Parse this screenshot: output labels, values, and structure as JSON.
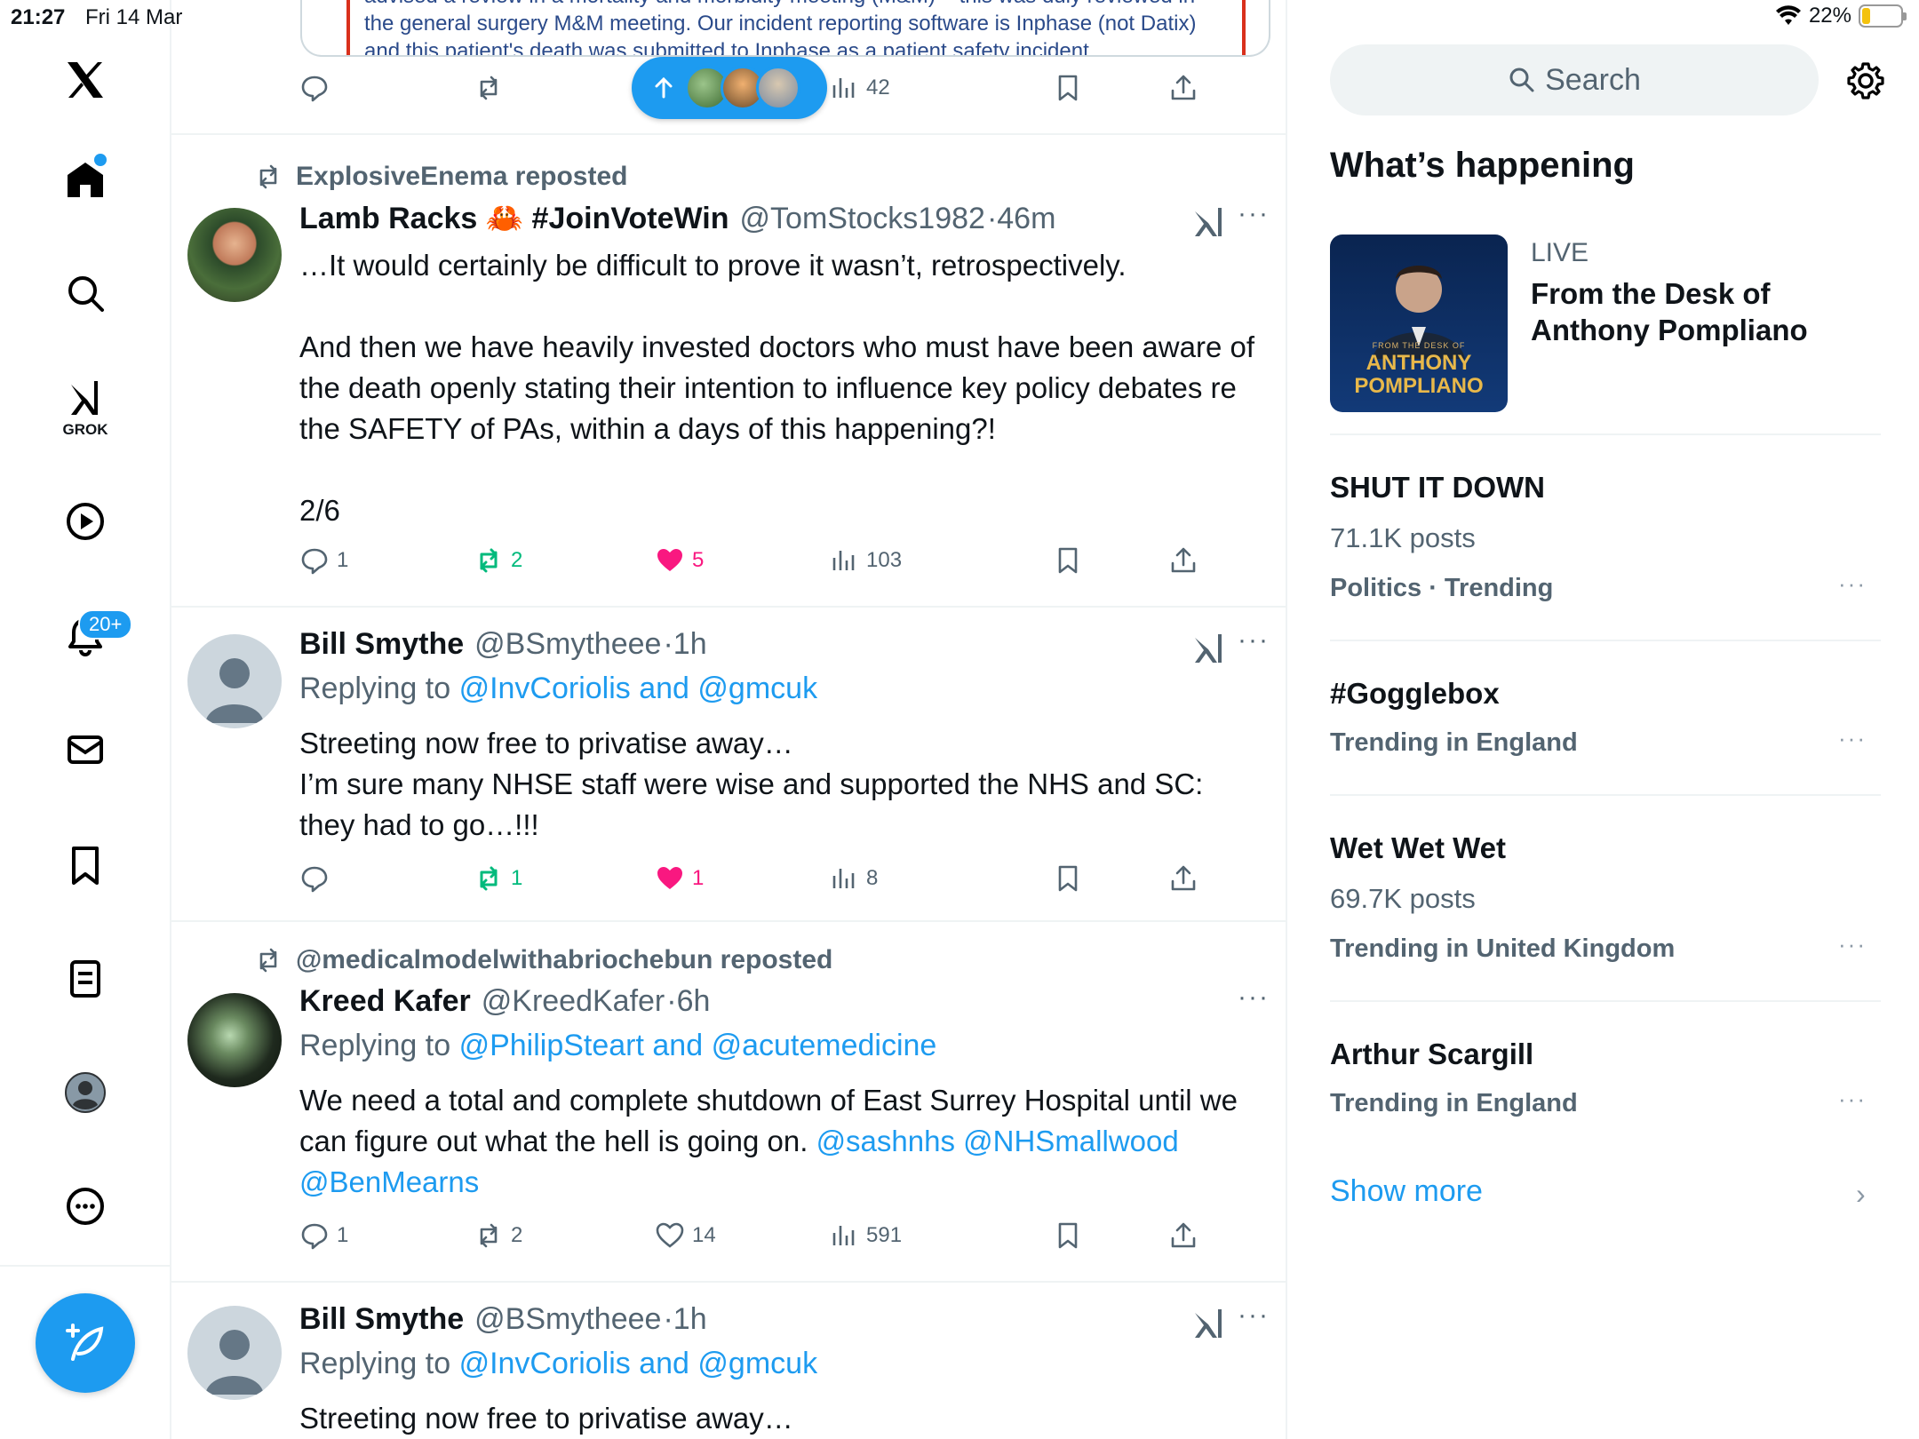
{
  "status_bar": {
    "time": "21:27",
    "date": "Fri 14 Mar",
    "battery": "22%",
    "battery_level": 0.22
  },
  "nav": {
    "grok_label": "GROK",
    "notifications_badge": "20+"
  },
  "top_post": {
    "quote_text_1": "advised a review in a mortality and morbidity meeting (M&M) – this was duly reviewed in",
    "quote_text_2": "the general surgery M&M meeting. Our incident reporting software is Inphase (not Datix)",
    "quote_text_3": "and this patient's death was submitted to Inphase as a patient safety incident",
    "views": "42"
  },
  "posts": [
    {
      "repost_by": "ExplosiveEnema reposted",
      "name": "Lamb Racks 🦀 #JoinVoteWin",
      "handle": "@TomStocks1982",
      "time": "46m",
      "text_1": "…It would certainly be difficult to prove it wasn’t, retrospectively.",
      "text_2": "And then we have heavily invested doctors who must have been aware of the death openly stating their intention to influence key policy debates re the SAFETY of PAs, within a days of this happening?!",
      "text_3": "2/6",
      "replies": "1",
      "reposts": "2",
      "likes": "5",
      "views": "103"
    },
    {
      "name": "Bill Smythe",
      "handle": "@BSmytheee",
      "time": "1h",
      "replying_prefix": "Replying to",
      "replying_to": "@InvCoriolis and @gmcuk",
      "text_1": "Streeting now free to privatise away…",
      "text_2": "I’m sure many NHSE staff were wise and supported the NHS and SC: they had to go…!!!",
      "replies": "",
      "reposts": "1",
      "likes": "1",
      "views": "8"
    },
    {
      "repost_by": "@medicalmodelwithabriochebun reposted",
      "name": "Kreed Kafer",
      "handle": "@KreedKafer",
      "time": "6h",
      "replying_prefix": "Replying to",
      "replying_to": "@PhilipSteart and @acutemedicine",
      "text_1": "We need a total and complete shutdown of East Surrey Hospital until we can figure out what the hell is going on.",
      "mentions": "@sashnhs @NHSmallwood @BenMearns",
      "replies": "1",
      "reposts": "2",
      "likes": "14",
      "views": "591"
    },
    {
      "name": "Bill Smythe",
      "handle": "@BSmytheee",
      "time": "1h",
      "replying_prefix": "Replying to",
      "replying_to": "@InvCoriolis and @gmcuk",
      "text_1": "Streeting now free to privatise away…"
    }
  ],
  "sidebar": {
    "search_placeholder": "Search",
    "whats_happening": "What’s happening",
    "live_tag": "LIVE",
    "live_title": "From the Desk of Anthony Pompliano",
    "live_image_caption_small": "FROM THE DESK OF",
    "live_image_caption_1": "ANTHONY",
    "live_image_caption_2": "POMPLIANO",
    "trends": [
      {
        "name": "SHUT IT DOWN",
        "posts": "71.1K posts",
        "context": "Politics · Trending"
      },
      {
        "name": "#Gogglebox",
        "context": "Trending in England"
      },
      {
        "name": "Wet Wet Wet",
        "posts": "69.7K posts",
        "context": "Trending in United Kingdom"
      },
      {
        "name": "Arthur Scargill",
        "context": "Trending in England"
      }
    ],
    "show_more": "Show more"
  },
  "colors": {
    "accent": "#1d9bf0",
    "repost_green": "#00ba7c",
    "like_pink": "#f91880",
    "muted": "#536471"
  }
}
